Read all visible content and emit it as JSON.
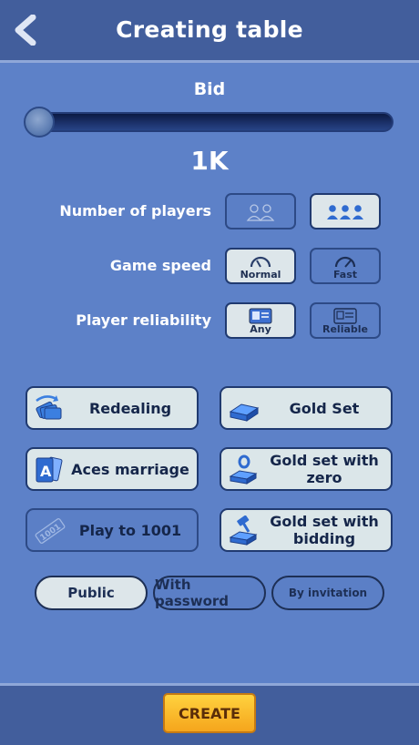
{
  "header": {
    "title": "Creating table"
  },
  "bid": {
    "label": "Bid",
    "value": "1K",
    "slider_fraction": 0.0
  },
  "players": {
    "label": "Number of players",
    "options": [
      {
        "icon": "two-players-icon",
        "selected": false
      },
      {
        "icon": "three-players-icon",
        "selected": true
      }
    ]
  },
  "speed": {
    "label": "Game speed",
    "options": [
      {
        "label": "Normal",
        "icon": "speedometer-normal-icon",
        "selected": true
      },
      {
        "label": "Fast",
        "icon": "speedometer-fast-icon",
        "selected": false
      }
    ]
  },
  "reliability": {
    "label": "Player reliability",
    "options": [
      {
        "label": "Any",
        "icon": "player-card-icon",
        "selected": true
      },
      {
        "label": "Reliable",
        "icon": "certificate-icon",
        "selected": false
      }
    ]
  },
  "features": [
    {
      "label": "Redealing",
      "icon": "cards-redeal-icon",
      "selected": true
    },
    {
      "label": "Gold Set",
      "icon": "gold-bar-icon",
      "selected": true
    },
    {
      "label": "Aces marriage",
      "icon": "ace-cards-icon",
      "selected": true
    },
    {
      "label": "Gold set with zero",
      "icon": "gold-bar-zero-icon",
      "selected": true
    },
    {
      "label": "Play to 1001",
      "icon": "play-to-1001-icon",
      "selected": false
    },
    {
      "label": "Gold set with bidding",
      "icon": "gold-bar-gavel-icon",
      "selected": true
    }
  ],
  "access": [
    {
      "label": "Public",
      "selected": true
    },
    {
      "label": "With password",
      "selected": false
    },
    {
      "label": "By invitation",
      "selected": false
    }
  ],
  "footer": {
    "create_label": "CREATE"
  },
  "colors": {
    "background": "#5d81c8",
    "header": "#425e9c",
    "selected": "#dde6ea",
    "border": "#203a70",
    "create": "#f5a51c"
  }
}
